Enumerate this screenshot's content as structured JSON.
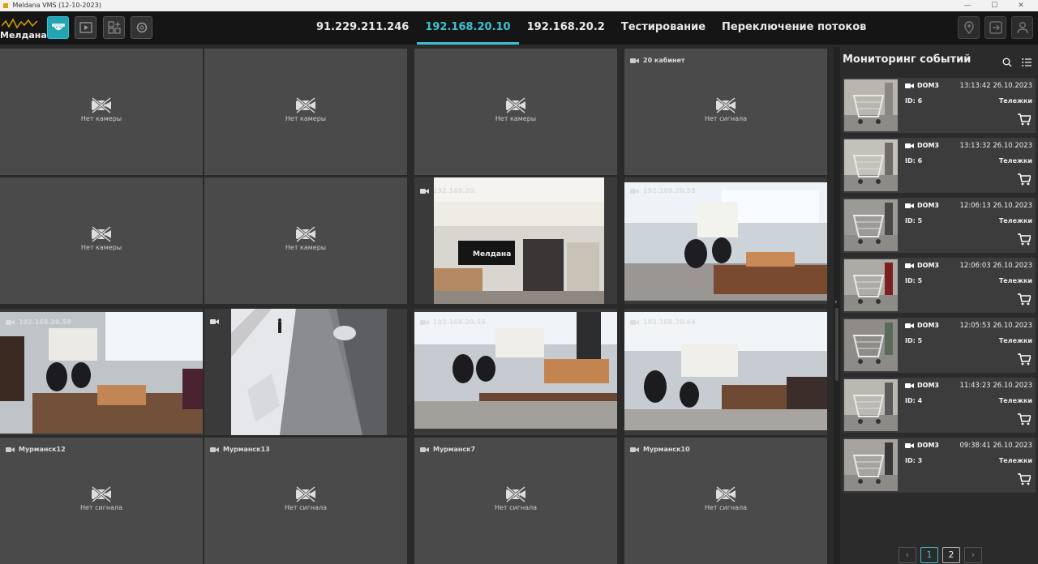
{
  "window": {
    "title": "Meldana VMS (12-10-2023)"
  },
  "brand": {
    "name": "Мелдана"
  },
  "toolbar": {
    "buttons": [
      {
        "icon": "dome-camera-icon",
        "active": true
      },
      {
        "icon": "playback-icon",
        "active": false
      },
      {
        "icon": "layout-add-icon",
        "active": false
      },
      {
        "icon": "settings-icon",
        "active": false
      }
    ]
  },
  "tabs": [
    {
      "label": "91.229.211.246",
      "active": false
    },
    {
      "label": "192.168.20.10",
      "active": true
    },
    {
      "label": "192.168.20.2",
      "active": false
    },
    {
      "label": "Тестирование",
      "active": false
    },
    {
      "label": "Переключение потоков",
      "active": false
    }
  ],
  "right_tools": [
    "map-pin-icon",
    "export-icon",
    "user-icon"
  ],
  "grid": {
    "cells": [
      {
        "label": "",
        "status": "Нет камеры"
      },
      {
        "label": "",
        "status": "Нет камеры"
      },
      {
        "label": "",
        "status": "Нет камеры"
      },
      {
        "label": "20 кабинет",
        "status": "Нет сигнала"
      },
      {
        "label": "",
        "status": "Нет камеры"
      },
      {
        "label": "",
        "status": "Нет камеры"
      },
      {
        "label": "192.168.20.",
        "status": "feed",
        "scene": "hall"
      },
      {
        "label": "192.168.20.58",
        "status": "feed",
        "scene": "office"
      },
      {
        "label": "192.168.20.59",
        "status": "feed",
        "scene": "office2"
      },
      {
        "label": "",
        "status": "feed",
        "scene": "street"
      },
      {
        "label": "192.168.20.55",
        "status": "feed",
        "scene": "office3"
      },
      {
        "label": "192.168.20.64",
        "status": "feed",
        "scene": "office4"
      },
      {
        "label": "Мурманск12",
        "status": "Нет сигнала"
      },
      {
        "label": "Мурманск13",
        "status": "Нет сигнала"
      },
      {
        "label": "Мурманск7",
        "status": "Нет сигнала"
      },
      {
        "label": "Мурманск10",
        "status": "Нет сигнала"
      }
    ]
  },
  "panel": {
    "title": "Мониторинг событий",
    "events": [
      {
        "camera": "DOM3",
        "time": "13:13:42 26.10.2023",
        "id": "ID: 6",
        "class": "Тележки"
      },
      {
        "camera": "DOM3",
        "time": "13:13:32 26.10.2023",
        "id": "ID: 6",
        "class": "Тележки"
      },
      {
        "camera": "DOM3",
        "time": "12:06:13 26.10.2023",
        "id": "ID: 5",
        "class": "Тележки"
      },
      {
        "camera": "DOM3",
        "time": "12:06:03 26.10.2023",
        "id": "ID: 5",
        "class": "Тележки"
      },
      {
        "camera": "DOM3",
        "time": "12:05:53 26.10.2023",
        "id": "ID: 5",
        "class": "Тележки"
      },
      {
        "camera": "DOM3",
        "time": "11:43:23 26.10.2023",
        "id": "ID: 4",
        "class": "Тележки"
      },
      {
        "camera": "DOM3",
        "time": "09:38:41 26.10.2023",
        "id": "ID: 3",
        "class": "Тележки"
      }
    ],
    "pager": {
      "pages": [
        "1",
        "2"
      ],
      "current": "1"
    }
  },
  "colors": {
    "accent": "#3ec0d0",
    "cell": "#4a4a4a",
    "panel": "#2b2b2b"
  }
}
